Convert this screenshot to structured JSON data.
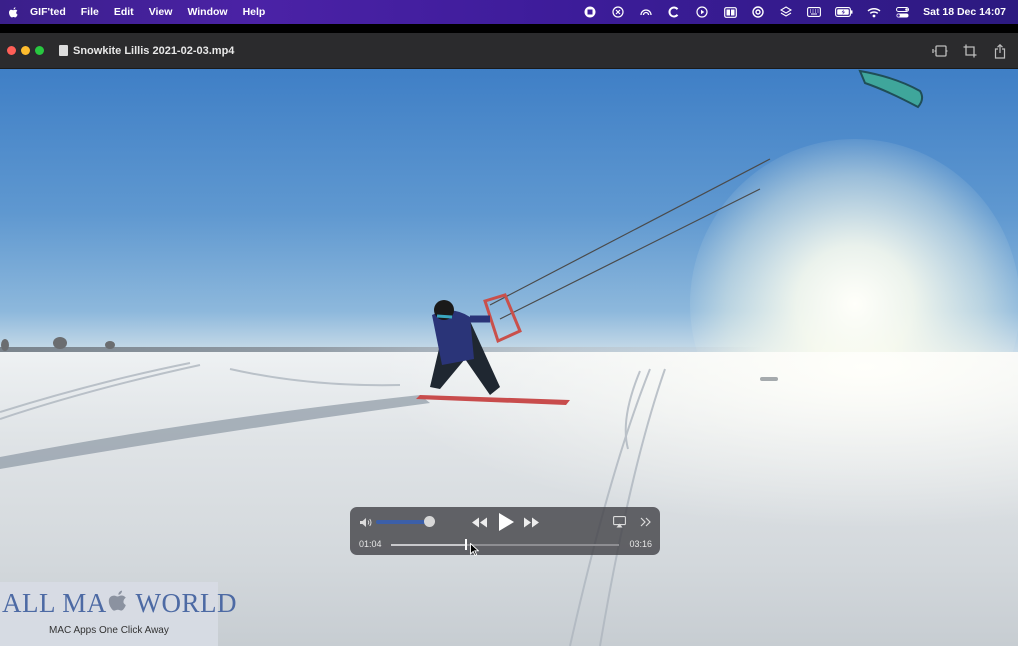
{
  "menubar": {
    "app_name": "GIF'ted",
    "menus": [
      "File",
      "Edit",
      "View",
      "Window",
      "Help"
    ],
    "clock": "Sat 18 Dec  14:07",
    "status_icons": [
      "record-icon",
      "close-circle-icon",
      "hotspot-icon",
      "c-app-icon",
      "play-circle-icon",
      "sidebar-icon",
      "at-icon",
      "layers-icon",
      "keyboard-icon",
      "battery-icon",
      "wifi-icon",
      "control-center-icon"
    ]
  },
  "window": {
    "title": "Snowkite Lillis 2021-02-03.mp4",
    "toolbar_icons": [
      "trim-icon",
      "crop-icon",
      "share-icon"
    ]
  },
  "player": {
    "current_time": "01:04",
    "total_time": "03:16",
    "progress": 0.33,
    "volume": 0.85,
    "accent_color": "#3c5fa8"
  },
  "watermark": {
    "logo_text_left": "ALL MA",
    "logo_text_right": " WORLD",
    "tagline": "MAC Apps One Click Away"
  }
}
